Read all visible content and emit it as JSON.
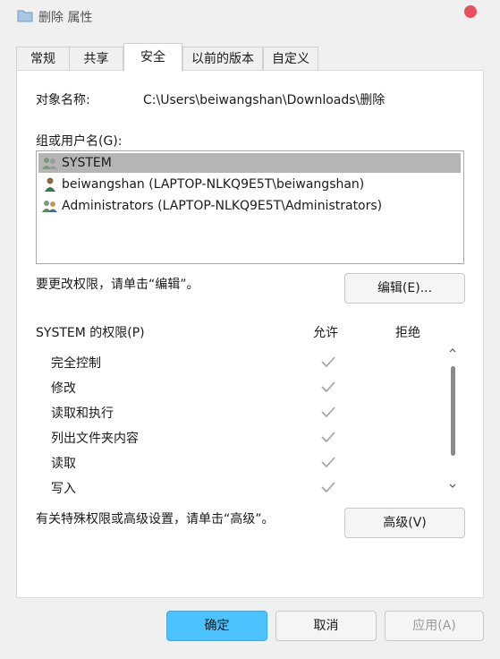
{
  "window": {
    "title": "删除 属性"
  },
  "tabs": [
    {
      "label": "常规"
    },
    {
      "label": "共享"
    },
    {
      "label": "安全"
    },
    {
      "label": "以前的版本"
    },
    {
      "label": "自定义"
    }
  ],
  "object": {
    "label": "对象名称:",
    "value": "C:\\Users\\beiwangshan\\Downloads\\删除"
  },
  "groups": {
    "label": "组或用户名(G):",
    "items": [
      {
        "name": "SYSTEM",
        "icon": "group-users-icon",
        "selected": true
      },
      {
        "name": "beiwangshan (LAPTOP-NLKQ9E5T\\beiwangshan)",
        "icon": "user-icon",
        "selected": false
      },
      {
        "name": "Administrators (LAPTOP-NLKQ9E5T\\Administrators)",
        "icon": "group-users-icon",
        "selected": false
      }
    ]
  },
  "edit_hint": "要更改权限，请单击“编辑”。",
  "edit_button": "编辑(E)...",
  "permissions": {
    "title": "SYSTEM 的权限(P)",
    "allow_header": "允许",
    "deny_header": "拒绝",
    "rows": [
      {
        "name": "完全控制",
        "allow": true,
        "deny": false
      },
      {
        "name": "修改",
        "allow": true,
        "deny": false
      },
      {
        "name": "读取和执行",
        "allow": true,
        "deny": false
      },
      {
        "name": "列出文件夹内容",
        "allow": true,
        "deny": false
      },
      {
        "name": "读取",
        "allow": true,
        "deny": false
      },
      {
        "name": "写入",
        "allow": true,
        "deny": false
      }
    ]
  },
  "advanced_hint": "有关特殊权限或高级设置，请单击“高级”。",
  "advanced_button": "高级(V)",
  "footer": {
    "ok": "确定",
    "cancel": "取消",
    "apply": "应用(A)"
  },
  "colors": {
    "accent": "#4cc2ff",
    "selection": "#b5b5b5",
    "close": "#e8505b"
  }
}
